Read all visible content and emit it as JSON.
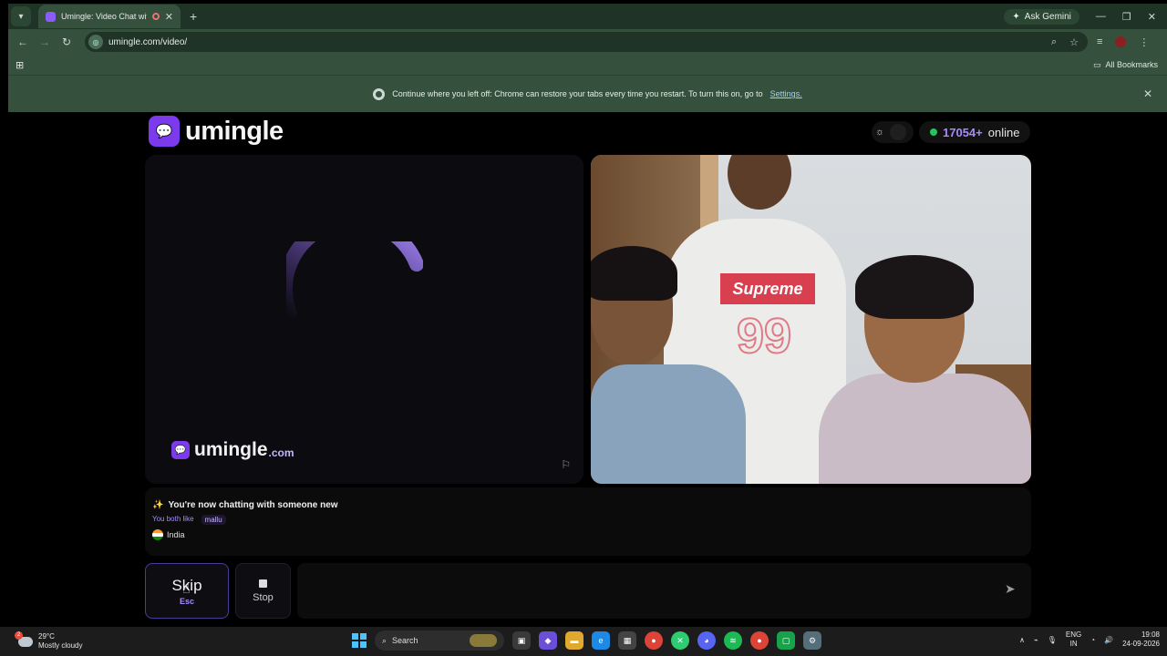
{
  "browser": {
    "tab_title": "Umingle: Video Chat with Str",
    "new_tab_icon": "+",
    "ask_gemini": "Ask Gemini",
    "url": "umingle.com/video/",
    "bookmarks_label": "All Bookmarks",
    "infobar_text": "Continue where you left off: Chrome can restore your tabs every time you restart. To turn this on, go to",
    "infobar_link": "Settings."
  },
  "header": {
    "logo_text": "umingle",
    "online_count": "17054+",
    "online_label": "online"
  },
  "video_left": {
    "watermark_text": "umingle",
    "watermark_tld": ".com"
  },
  "video_right": {
    "shirt_text": "Supreme",
    "shirt_number": "99"
  },
  "chat": {
    "status": "You're now chatting with someone new",
    "common_label": "You both like",
    "common_interest": "mallu",
    "country": "India"
  },
  "controls": {
    "skip_label": "Skip",
    "skip_key": "Esc",
    "stop_label": "Stop",
    "message_placeholder": ""
  },
  "taskbar": {
    "temperature": "29°C",
    "weather": "Mostly cloudy",
    "weather_badge": "2",
    "search_label": "Search",
    "lang_top": "ENG",
    "lang_bottom": "IN",
    "time": "19:08",
    "date": "24-09-2026"
  },
  "colors": {
    "accent": "#7c3aed",
    "accent_light": "#a78bfa",
    "online_dot": "#22c55e",
    "chrome_bg": "#35503d"
  }
}
